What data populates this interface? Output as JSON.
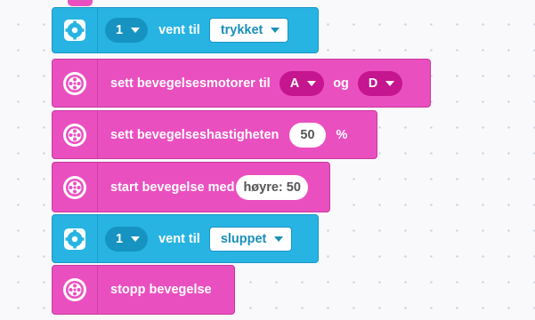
{
  "blocks": [
    {
      "type": "sensor",
      "icon": "sensor-icon",
      "port": "1",
      "text": "vent til",
      "state": "trykket"
    },
    {
      "type": "motor",
      "icon": "motor-icon",
      "text": "sett bevegelsesmotorer til",
      "port_a": "A",
      "joiner": "og",
      "port_b": "D"
    },
    {
      "type": "motor",
      "icon": "motor-icon",
      "text": "sett bevegelseshastigheten",
      "value": "50",
      "unit": "%"
    },
    {
      "type": "motor",
      "icon": "motor-icon",
      "text": "start bevegelse med",
      "value": "høyre: 50"
    },
    {
      "type": "sensor",
      "icon": "sensor-icon",
      "port": "1",
      "text": "vent til",
      "state": "sluppet"
    },
    {
      "type": "motor",
      "icon": "motor-icon",
      "text": "stopp bevegelse"
    }
  ],
  "colors": {
    "sensor_block": "#27b4e3",
    "motor_block": "#ea4fc0",
    "workspace": "#f9f9fb"
  }
}
